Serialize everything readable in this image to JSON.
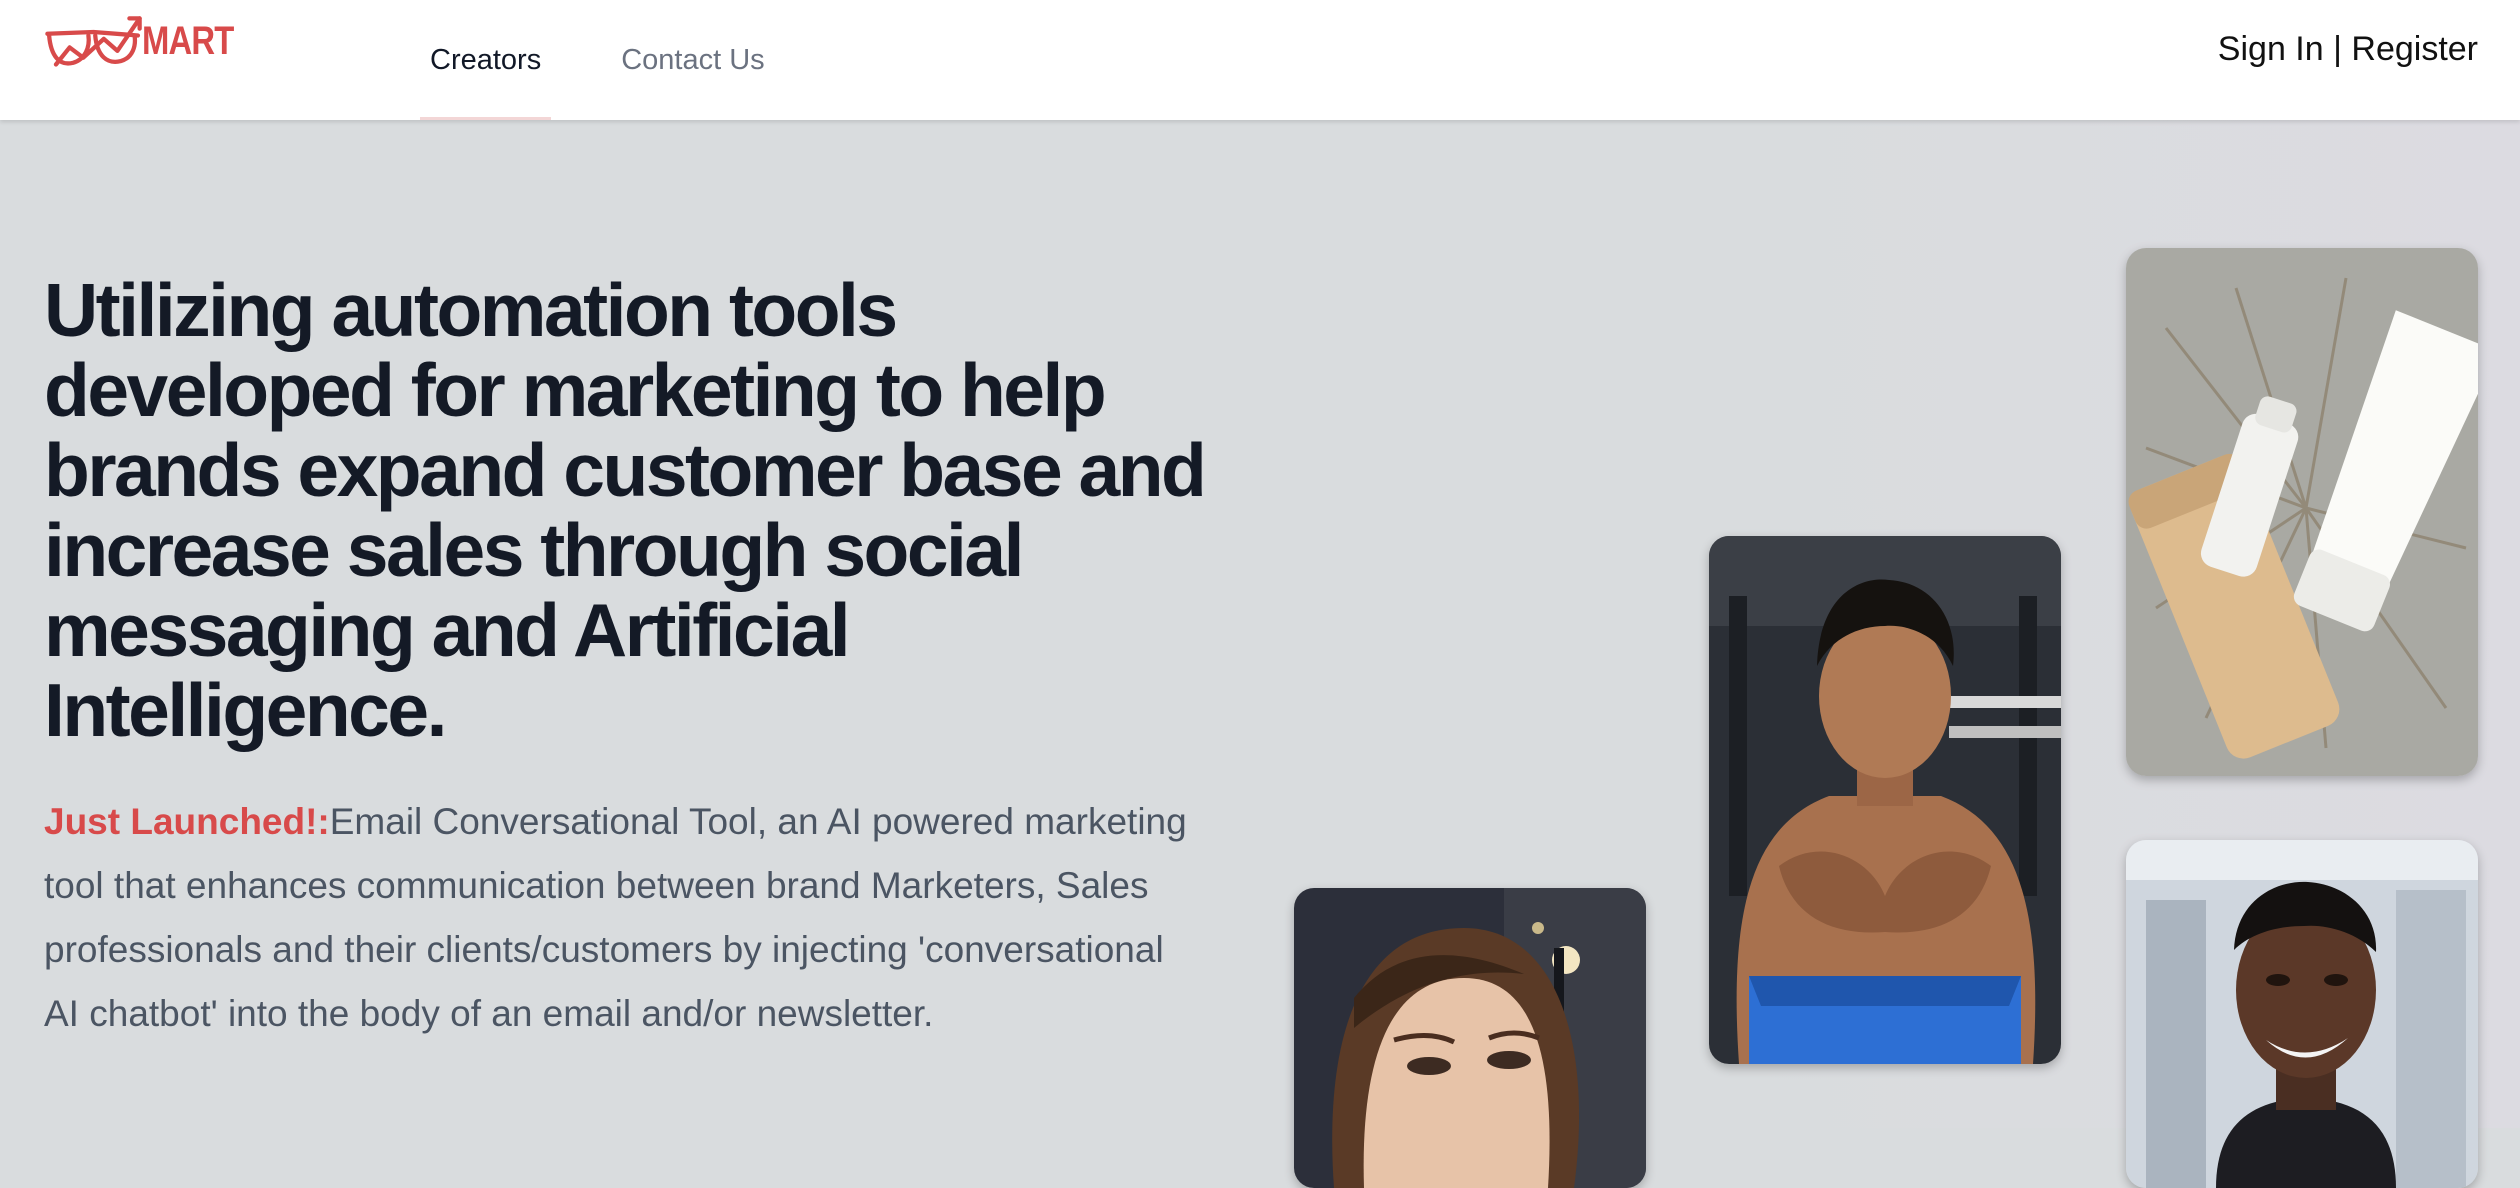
{
  "brand": {
    "logo_text": "MART",
    "accent": "#d84a4a"
  },
  "nav": {
    "items": [
      {
        "label": "Creators",
        "active": true
      },
      {
        "label": "Contact Us",
        "active": false
      }
    ]
  },
  "auth": {
    "sign_in": "Sign In",
    "separator": " | ",
    "register": "Register"
  },
  "hero": {
    "headline": "Utilizing automation tools developed for marketing to help brands expand customer base and increase sales through social messaging and Artificial Intelligence.",
    "highlight": "Just Launched!:",
    "description": "Email Conversational Tool, an AI powered marketing tool that enhances communication between brand Marketers, Sales professionals and their clients/customers by injecting 'conversational AI chatbot' into the body of an email and/or newsletter."
  },
  "gallery": [
    {
      "subject": "woman-portrait"
    },
    {
      "subject": "fitness-man"
    },
    {
      "subject": "cosmetic-tubes"
    },
    {
      "subject": "smiling-man-gym"
    }
  ]
}
